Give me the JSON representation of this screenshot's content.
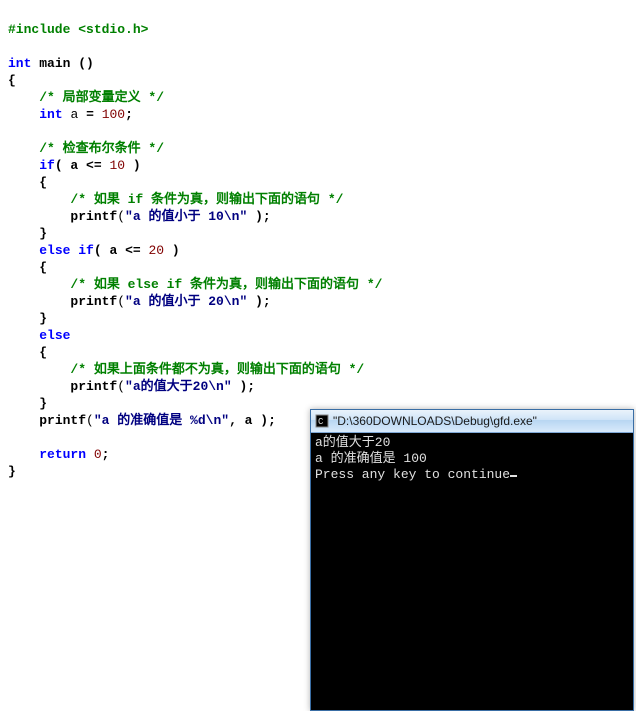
{
  "code": {
    "include_line": "#include <stdio.h>",
    "kw_int": "int",
    "main_decl": "main ()",
    "brace_open": "{",
    "brace_close": "}",
    "cmt_var": "/* 局部变量定义 */",
    "decl_a": "a",
    "eq": "=",
    "hundred": "100",
    "semi": ";",
    "cmt_bool": "/* 检查布尔条件 */",
    "kw_if": "if",
    "kw_else": "else",
    "cond1_open": "( a <=",
    "cond1_num": "10",
    "paren_close": " )",
    "cmt_if": "/* 如果 if 条件为真，则输出下面的语句 */",
    "printf": "printf",
    "str1": "\"a 的值小于 10\\n\"",
    "tail": " );",
    "cond2_open": "( a <=",
    "cond2_num": "20",
    "cmt_elseif": "/* 如果 else if 条件为真，则输出下面的语句 */",
    "str2": "\"a 的值小于 20\\n\"",
    "cmt_else": "/* 如果上面条件都不为真，则输出下面的语句 */",
    "str3": "\"a的值大于20\\n\"",
    "str4": "\"a 的准确值是 %d\\n\"",
    "args4": ", a );",
    "kw_return": "return",
    "zero": "0"
  },
  "console": {
    "title": "\"D:\\360DOWNLOADS\\Debug\\gfd.exe\"",
    "line1": "a的值大于20",
    "line2": "a 的准确值是 100",
    "line3": "Press any key to continue"
  }
}
